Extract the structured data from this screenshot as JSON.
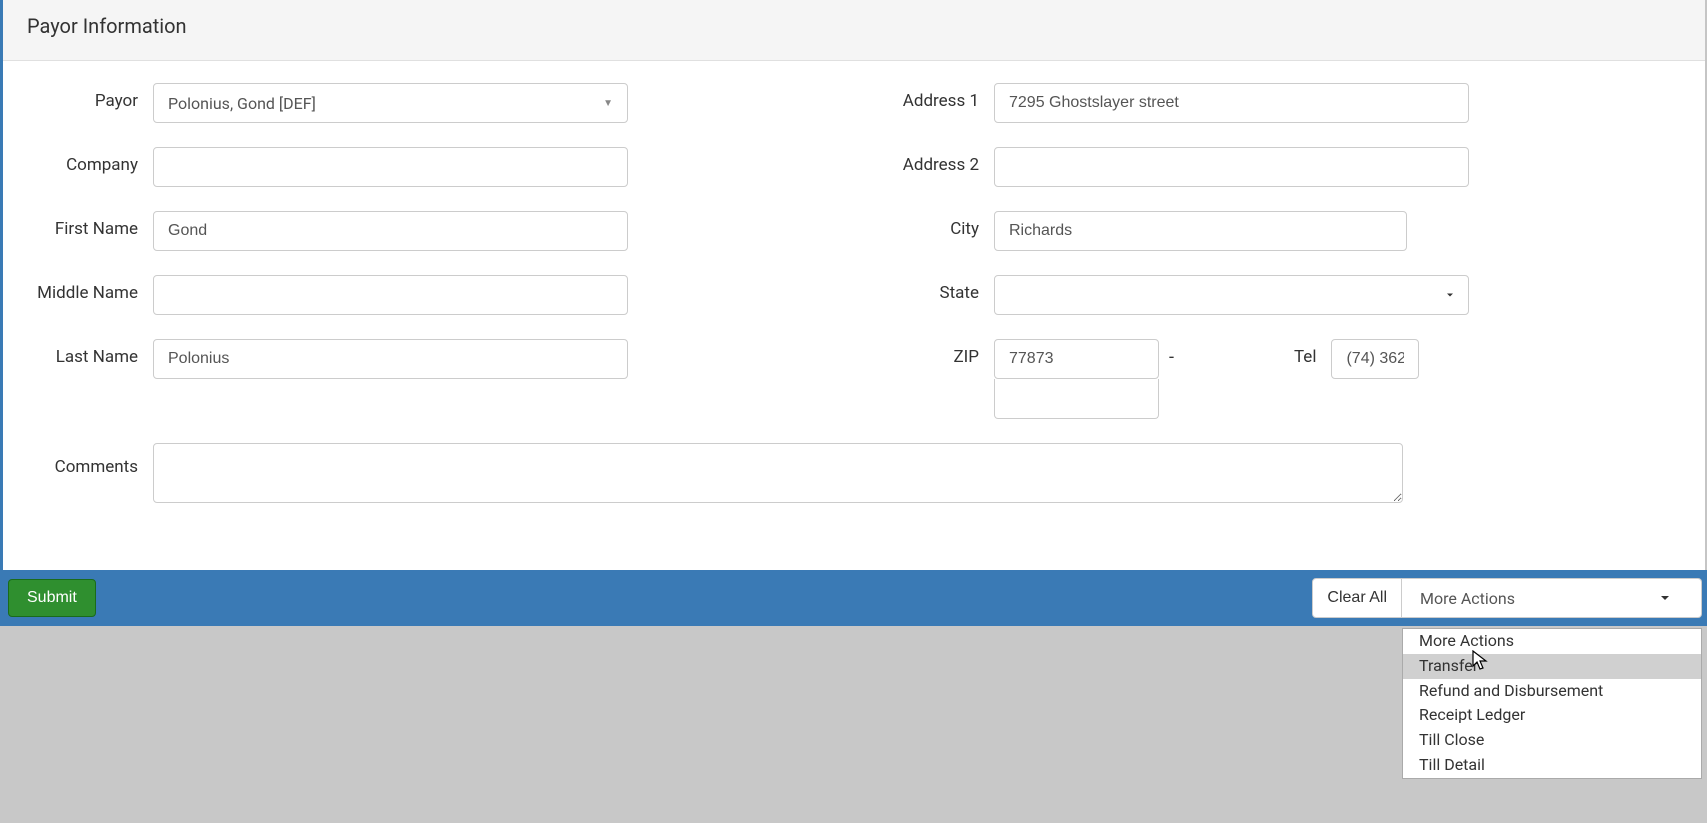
{
  "panel": {
    "title": "Payor Information"
  },
  "labels": {
    "payor": "Payor",
    "company": "Company",
    "firstName": "First Name",
    "middleName": "Middle Name",
    "lastName": "Last Name",
    "address1": "Address 1",
    "address2": "Address 2",
    "city": "City",
    "state": "State",
    "zip": "ZIP",
    "tel": "Tel",
    "comments": "Comments",
    "zipDash": "-"
  },
  "values": {
    "payor": "Polonius, Gond [DEF]",
    "company": "",
    "firstName": "Gond",
    "middleName": "",
    "lastName": "Polonius",
    "address1": "7295 Ghostslayer street",
    "address2": "",
    "city": "Richards",
    "state": "",
    "zip": "77873",
    "zip2": "",
    "tel": "(74) 362",
    "comments": ""
  },
  "footer": {
    "submit": "Submit",
    "clearAll": "Clear All",
    "moreActions": "More Actions"
  },
  "dropdown": {
    "items": [
      {
        "label": "More Actions",
        "highlighted": false
      },
      {
        "label": "Transfer",
        "highlighted": true
      },
      {
        "label": "Refund and Disbursement",
        "highlighted": false
      },
      {
        "label": "Receipt Ledger",
        "highlighted": false
      },
      {
        "label": "Till Close",
        "highlighted": false
      },
      {
        "label": "Till Detail",
        "highlighted": false
      }
    ]
  }
}
